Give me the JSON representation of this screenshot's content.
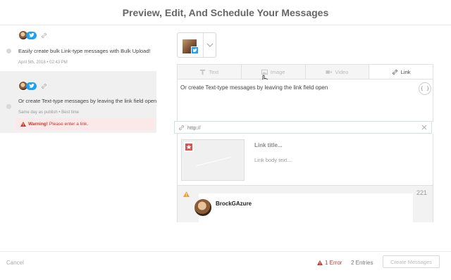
{
  "modal": {
    "title": "Preview, Edit, And Schedule Your Messages"
  },
  "messages": [
    {
      "text": "Easily create bulk Link-type messages with Bulk Upload!",
      "meta": "April 5th, 2018 • 02:43 PM",
      "selected": false
    },
    {
      "text": "Or create Text-type messages by leaving the link field open",
      "meta": "Same day as publish • Best time",
      "selected": true,
      "warning": {
        "label": "Warning!",
        "text": "Please enter a link."
      }
    }
  ],
  "composer": {
    "tabs": [
      {
        "label": "Text",
        "icon": "text-icon",
        "active": false
      },
      {
        "label": "Image",
        "icon": "image-icon",
        "active": false
      },
      {
        "label": "Video",
        "icon": "video-icon",
        "active": false
      },
      {
        "label": "Link",
        "icon": "link-icon",
        "active": true
      }
    ],
    "text": "Or create Text-type messages by leaving the link field open",
    "variables_button": "{ }",
    "url_placeholder": "http://"
  },
  "link_preview": {
    "title": "Link title...",
    "body": "Link body text..."
  },
  "tweet_preview": {
    "char_count": "221",
    "username": "BrockGAzure"
  },
  "footer": {
    "cancel": "Cancel",
    "errors": "1 Error",
    "entries": "2 Entries",
    "create_button": "Create Messages"
  },
  "colors": {
    "twitter": "#1da1f2",
    "error": "#c0392b",
    "warning_bg": "#fbe8e8",
    "selected_bg": "#f0f0f0"
  }
}
